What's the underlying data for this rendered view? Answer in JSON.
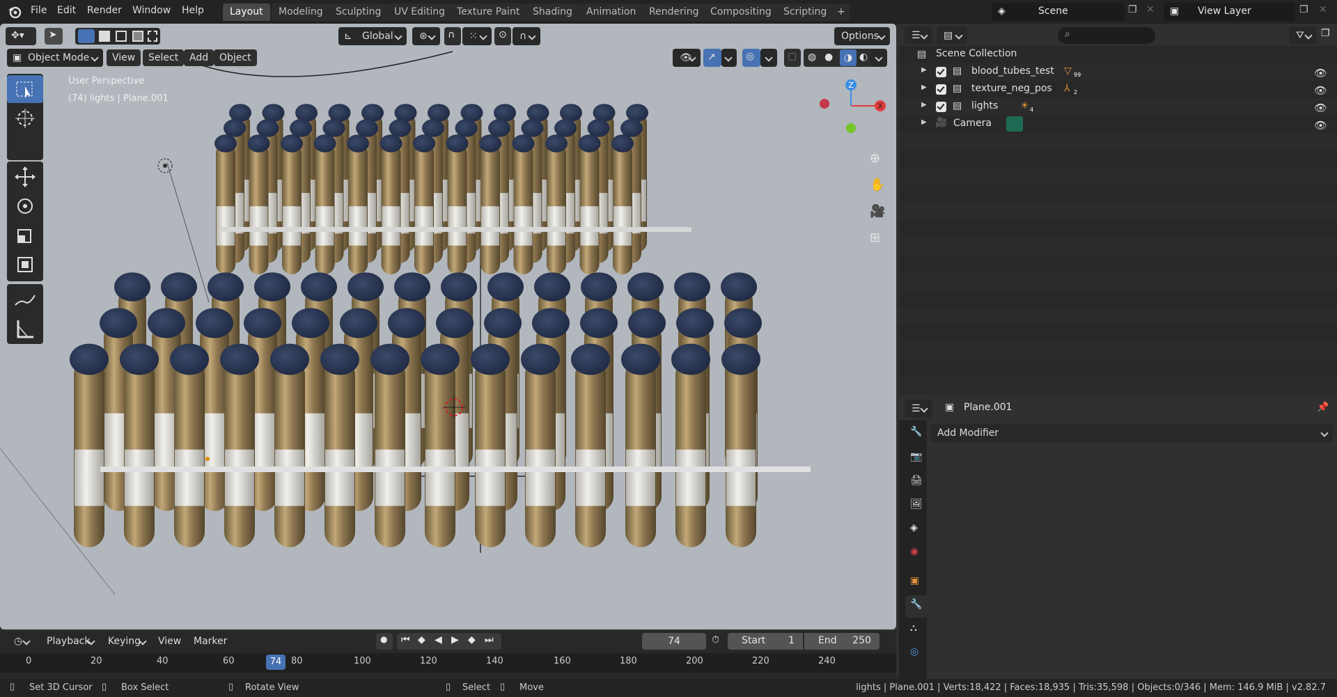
{
  "menu": {
    "file": "File",
    "edit": "Edit",
    "render": "Render",
    "window": "Window",
    "help": "Help"
  },
  "workspaces": [
    "Layout",
    "Modeling",
    "Sculpting",
    "UV Editing",
    "Texture Paint",
    "Shading",
    "Animation",
    "Rendering",
    "Compositing",
    "Scripting"
  ],
  "add_workspace": "+",
  "scene": {
    "name": "Scene",
    "view_layer": "View Layer"
  },
  "viewport": {
    "transform_orientation": "Global",
    "options_label": "Options",
    "mode": "Object Mode",
    "menus": {
      "view": "View",
      "select": "Select",
      "add": "Add",
      "object": "Object"
    },
    "overlay_line1": "User Perspective",
    "overlay_line2": "(74) lights | Plane.001",
    "gizmo": {
      "x": "X",
      "y": "Y",
      "z": "Z"
    }
  },
  "outliner": {
    "root": "Scene Collection",
    "items": [
      {
        "label": "blood_tubes_test",
        "badge": "99"
      },
      {
        "label": "texture_neg_pos",
        "badge": "2"
      },
      {
        "label": "lights",
        "badge": "4"
      },
      {
        "label": "Camera",
        "badge": ""
      }
    ]
  },
  "properties": {
    "object_name": "Plane.001",
    "add_modifier": "Add Modifier"
  },
  "timeline": {
    "playback": "Playback",
    "keying": "Keying",
    "view": "View",
    "marker": "Marker",
    "current_frame": "74",
    "start_label": "Start",
    "start_value": "1",
    "end_label": "End",
    "end_value": "250",
    "ticks": [
      "0",
      "20",
      "40",
      "60",
      "80",
      "100",
      "120",
      "140",
      "160",
      "180",
      "200",
      "220",
      "240"
    ],
    "current_tick": "74"
  },
  "status": {
    "left1": "Set 3D Cursor",
    "left2": "Box Select",
    "left3": "Rotate View",
    "mid1": "Select",
    "mid2": "Move",
    "stats": "lights | Plane.001 | Verts:18,422 | Faces:18,935 | Tris:35,598 | Objects:0/346 | Mem: 146.9 MiB | v2.82.7"
  },
  "colors": {
    "accent": "#4772b3",
    "viewport_bg": "#b1b7bd",
    "cap": "#2a3752",
    "tube": "#a08a62",
    "label": "#e8e6e0",
    "x_axis": "#e13c3c",
    "y_axis": "#7ec834",
    "z_axis": "#3d8ee0"
  }
}
